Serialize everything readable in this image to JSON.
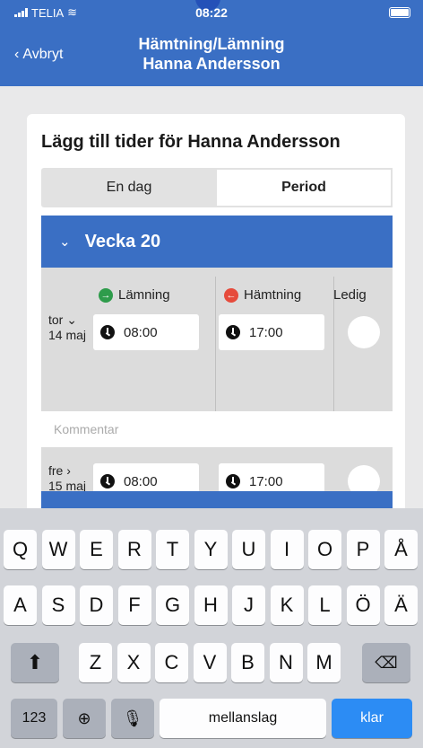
{
  "status": {
    "carrier": "TELIA",
    "time": "08:22"
  },
  "nav": {
    "back_label": "Avbryt",
    "title_line1": "Hämtning/Lämning",
    "title_line2": "Hanna Andersson"
  },
  "card": {
    "title": "Lägg till tider för Hanna Andersson",
    "tabs": {
      "day": "En dag",
      "period": "Period",
      "selected": "Period"
    },
    "week": {
      "label": "Vecka 20"
    },
    "columns": {
      "drop": "Lämning",
      "pickup": "Hämtning",
      "free": "Ledig"
    },
    "rows": [
      {
        "weekday": "tor",
        "date": "14 maj",
        "chevron": "⌄",
        "drop": "08:00",
        "pickup": "17:00"
      },
      {
        "weekday": "fre",
        "date": "15 maj",
        "chevron": "›",
        "drop": "08:00",
        "pickup": "17:00"
      }
    ],
    "comment_placeholder": "Kommentar"
  },
  "keyboard": {
    "row1": [
      "Q",
      "W",
      "E",
      "R",
      "T",
      "Y",
      "U",
      "I",
      "O",
      "P",
      "Å"
    ],
    "row2": [
      "A",
      "S",
      "D",
      "F",
      "G",
      "H",
      "J",
      "K",
      "L",
      "Ö",
      "Ä"
    ],
    "row3": [
      "Z",
      "X",
      "C",
      "V",
      "B",
      "N",
      "M"
    ],
    "numbers": "123",
    "space": "mellanslag",
    "return": "klar"
  }
}
